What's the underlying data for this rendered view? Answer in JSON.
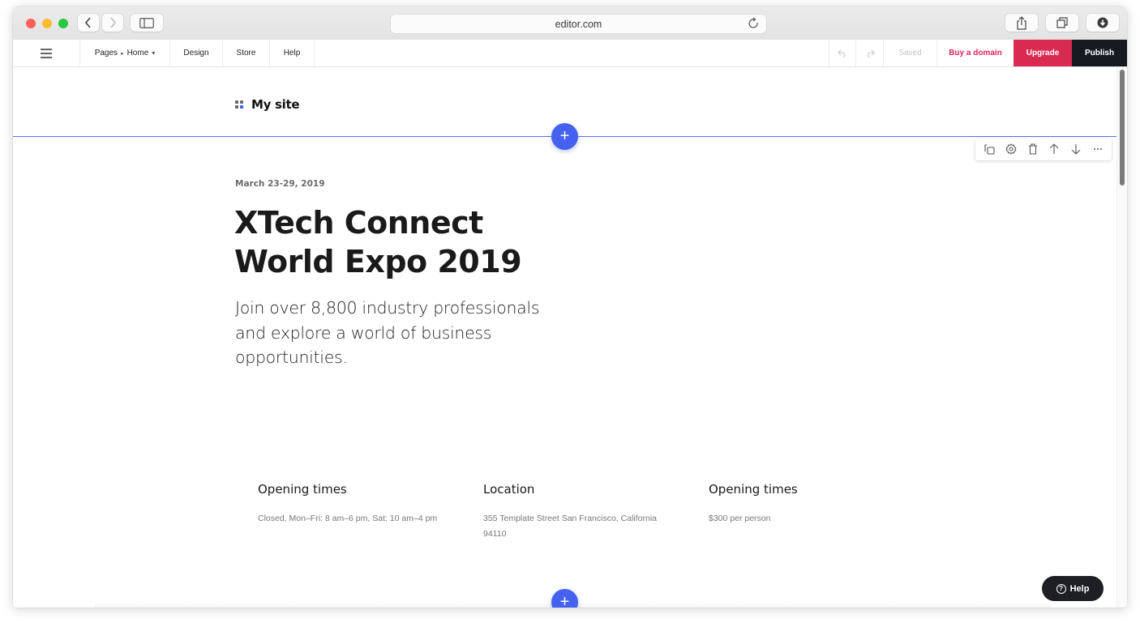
{
  "browser": {
    "url": "editor.com",
    "icons": {
      "back": "chevron-left-icon",
      "forward": "chevron-right-icon",
      "sidebar": "sidebar-icon",
      "reload": "reload-icon",
      "share": "share-icon",
      "tabs": "tabs-icon",
      "download": "download-icon"
    }
  },
  "editor_bar": {
    "menu_icon": "hamburger-icon",
    "pages_label": "Pages",
    "breadcrumb_sep": "▸",
    "current_page": "Home",
    "page_dropdown": "▾",
    "design_label": "Design",
    "store_label": "Store",
    "help_label": "Help",
    "saved_label": "Saved",
    "buy_domain_label": "Buy a domain",
    "upgrade_label": "Upgrade",
    "publish_label": "Publish"
  },
  "site": {
    "name": "My site"
  },
  "block_tools": [
    "duplicate-icon",
    "settings-icon",
    "trash-icon",
    "move-up-icon",
    "move-down-icon",
    "more-icon"
  ],
  "hero": {
    "date": "March 23-29, 2019",
    "title": "XTech Connect World Expo 2019",
    "subtitle": "Join over 8,800 industry professionals and explore a world of business opportunities."
  },
  "info": [
    {
      "title": "Opening times",
      "text": "Closed, Mon–Fri: 8 am–6 pm, Sat: 10 am–4 pm"
    },
    {
      "title": "Location",
      "text": "355 Template Street San Francisco, California 94110"
    },
    {
      "title": "Opening times",
      "text": "$300 per person"
    }
  ],
  "add_section_label": "+",
  "help_button": {
    "label": "Help",
    "icon": "?"
  },
  "colors": {
    "accent": "#4462ef",
    "upgrade": "#d92b52",
    "publish": "#161a20",
    "domain_link": "#e0245a"
  }
}
